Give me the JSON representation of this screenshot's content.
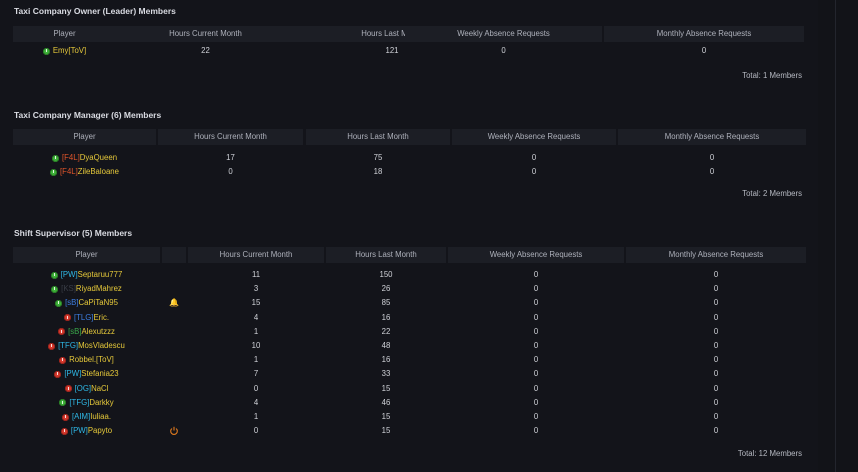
{
  "colors": {
    "online": "#3fb23a",
    "offline": "#d63a2e",
    "player_name": "#e6c93a",
    "icon_orange": "#e07b1f"
  },
  "sections": [
    {
      "title": "Taxi Company Owner (Leader) Members",
      "headers": [
        "Player",
        "Hours Current Month",
        "Hours Last Month",
        "Weekly Absence Requests",
        "Monthly Absence Requests"
      ],
      "rows": [
        {
          "status": "online",
          "tag": "",
          "tag_color": "",
          "name": "Emy[ToV]",
          "hours_current": "22",
          "hours_last": "121",
          "weekly": "0",
          "monthly": "0"
        }
      ],
      "total": "Total: 1 Members"
    },
    {
      "title": "Taxi Company Manager (6) Members",
      "headers": [
        "Player",
        "Hours Current Month",
        "Hours Last Month",
        "Weekly Absence Requests",
        "Monthly Absence Requests"
      ],
      "rows": [
        {
          "status": "online",
          "tag": "[F4L]",
          "tag_color": "#e0552a",
          "name": "DyaQueen",
          "hours_current": "17",
          "hours_last": "75",
          "weekly": "0",
          "monthly": "0"
        },
        {
          "status": "online",
          "tag": "[F4L]",
          "tag_color": "#e0552a",
          "name": "ZileBaloane",
          "hours_current": "0",
          "hours_last": "18",
          "weekly": "0",
          "monthly": "0"
        }
      ],
      "total": "Total: 2 Members"
    },
    {
      "title": "Shift Supervisor (5) Members",
      "headers": [
        "Player",
        "",
        "Hours Current Month",
        "Hours Last Month",
        "Weekly Absence Requests",
        "Monthly Absence Requests"
      ],
      "rows": [
        {
          "status": "online",
          "tag": "[PW]",
          "tag_color": "#2fb8e6",
          "name": "Septaruu777",
          "hours_current": "11",
          "hours_last": "150",
          "weekly": "0",
          "monthly": "0",
          "icon": ""
        },
        {
          "status": "online",
          "tag": "[KS]",
          "tag_color": "#3a3d46",
          "name": "RiyadMahrez",
          "hours_current": "3",
          "hours_last": "26",
          "weekly": "0",
          "monthly": "0",
          "icon": ""
        },
        {
          "status": "online",
          "tag": "[sB]",
          "tag_color": "#3d7de0",
          "name": "CaPiTaN95",
          "hours_current": "15",
          "hours_last": "85",
          "weekly": "0",
          "monthly": "0",
          "icon": "bell-icon"
        },
        {
          "status": "offline",
          "tag": "[TLG]",
          "tag_color": "#3d7de0",
          "name": "Eric.",
          "hours_current": "4",
          "hours_last": "16",
          "weekly": "0",
          "monthly": "0",
          "icon": ""
        },
        {
          "status": "offline",
          "tag": "[sB]",
          "tag_color": "#3aa84a",
          "name": "Alexutzzz",
          "hours_current": "1",
          "hours_last": "22",
          "weekly": "0",
          "monthly": "0",
          "icon": ""
        },
        {
          "status": "offline",
          "tag": "[TFG]",
          "tag_color": "#2fb8e6",
          "name": "MosVladescu",
          "hours_current": "10",
          "hours_last": "48",
          "weekly": "0",
          "monthly": "0",
          "icon": ""
        },
        {
          "status": "offline",
          "tag": "",
          "tag_color": "",
          "name": "Robbel.[ToV]",
          "hours_current": "1",
          "hours_last": "16",
          "weekly": "0",
          "monthly": "0",
          "icon": ""
        },
        {
          "status": "offline",
          "tag": "[PW]",
          "tag_color": "#2fb8e6",
          "name": "Stefania23",
          "hours_current": "7",
          "hours_last": "33",
          "weekly": "0",
          "monthly": "0",
          "icon": ""
        },
        {
          "status": "offline",
          "tag": "[OG]",
          "tag_color": "#2fb8e6",
          "name": "NaCl",
          "hours_current": "0",
          "hours_last": "15",
          "weekly": "0",
          "monthly": "0",
          "icon": ""
        },
        {
          "status": "online",
          "tag": "[TFG]",
          "tag_color": "#2fb8e6",
          "name": "Darkky",
          "hours_current": "4",
          "hours_last": "46",
          "weekly": "0",
          "monthly": "0",
          "icon": ""
        },
        {
          "status": "offline",
          "tag": "[AIM]",
          "tag_color": "#2fb8e6",
          "name": "Iuliaa.",
          "hours_current": "1",
          "hours_last": "15",
          "weekly": "0",
          "monthly": "0",
          "icon": ""
        },
        {
          "status": "offline",
          "tag": "[PW]",
          "tag_color": "#2fb8e6",
          "name": "Papyto",
          "hours_current": "0",
          "hours_last": "15",
          "weekly": "0",
          "monthly": "0",
          "icon": "power-icon"
        }
      ],
      "total": "Total: 12 Members"
    }
  ]
}
